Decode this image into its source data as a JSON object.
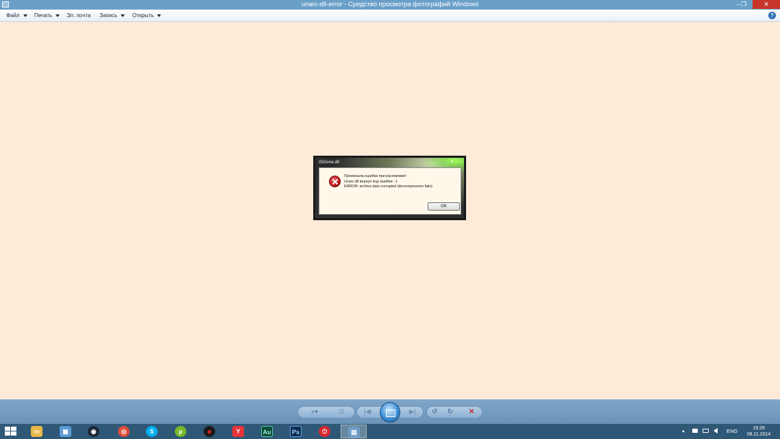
{
  "window": {
    "title": "unarc-dll-error - Средство просмотра фотографий Windows",
    "minimize_glyph": "‒",
    "maximize_glyph": "❐",
    "close_glyph": "✕"
  },
  "menu": {
    "items": [
      {
        "label": "Файл",
        "has_dropdown": true
      },
      {
        "label": "Печать",
        "has_dropdown": true
      },
      {
        "label": "Эл. почта",
        "has_dropdown": false
      },
      {
        "label": "Запись",
        "has_dropdown": true
      },
      {
        "label": "Открыть",
        "has_dropdown": true
      }
    ],
    "help_glyph": "?"
  },
  "image": {
    "background": "#fdebd8",
    "dialog": {
      "title": "ISDone.dll",
      "close_glyph": "x",
      "icon": "error-icon",
      "lines": [
        "Произошла ошибка при распаковке!",
        "Unarc.dll вернул код ошибки: -1",
        "ERROR: archive data corrupted (decompression fails)"
      ],
      "ok_label": "OK"
    }
  },
  "viewer_toolbar": {
    "zoom_glyph": "⌕▾",
    "actual_size_glyph": "⊡",
    "prev_glyph": "|◀",
    "next_glyph": "▶|",
    "rotate_ccw_glyph": "↺",
    "rotate_cw_glyph": "↻",
    "delete_glyph": "✕"
  },
  "taskbar": {
    "apps": [
      {
        "name": "file-explorer",
        "glyph": "▭",
        "color": "#e8b84a"
      },
      {
        "name": "control-panel",
        "glyph": "▣",
        "color": "#5a9bd4"
      },
      {
        "name": "steam",
        "glyph": "◉",
        "color": "#1b2838"
      },
      {
        "name": "chrome",
        "glyph": "◎",
        "color": "#dd4b39"
      },
      {
        "name": "skype",
        "glyph": "S",
        "color": "#00aff0"
      },
      {
        "name": "utorrent",
        "glyph": "µ",
        "color": "#76b82a"
      },
      {
        "name": "recorder",
        "glyph": "●",
        "color": "#d0211d"
      },
      {
        "name": "yandex-browser",
        "glyph": "Y",
        "color": "#e8343a"
      },
      {
        "name": "audition",
        "glyph": "Au",
        "color": "#0b4c3c"
      },
      {
        "name": "photoshop",
        "glyph": "Ps",
        "color": "#0f2a52"
      },
      {
        "name": "power",
        "glyph": "⏻",
        "color": "#d9272e"
      },
      {
        "name": "photo-viewer",
        "glyph": "▤",
        "color": "#6d9cc7"
      }
    ],
    "tray": {
      "show_hidden_glyph": "▲",
      "language": "ENG",
      "time": "19:28",
      "date": "08.11.2014"
    }
  }
}
